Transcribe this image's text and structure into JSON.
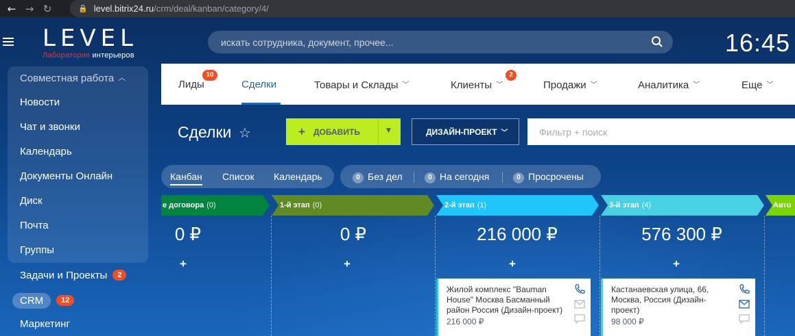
{
  "browser": {
    "url_host": "level.bitrix24.ru",
    "url_path": "/crm/deal/kanban/category/4/"
  },
  "header": {
    "logo_text": "LEVEL",
    "logo_sub_red": "Лаборатория",
    "logo_sub_rest": " интерьеров",
    "search_placeholder": "искать сотрудника, документ, прочее...",
    "clock": "16:45"
  },
  "sidebar": {
    "group_title": "Совместная работа",
    "items": [
      {
        "label": "Новости"
      },
      {
        "label": "Чат и звонки"
      },
      {
        "label": "Календарь"
      },
      {
        "label": "Документы Онлайн"
      },
      {
        "label": "Диск"
      },
      {
        "label": "Почта"
      },
      {
        "label": "Группы"
      }
    ],
    "tasks": {
      "label": "Задачи и Проекты",
      "badge": "2"
    },
    "crm": {
      "label": "CRM",
      "badge": "12"
    },
    "marketing": {
      "label": "Маркетинг"
    }
  },
  "topnav": {
    "tabs": [
      {
        "label": "Лиды",
        "counter": "10"
      },
      {
        "label": "Сделки"
      },
      {
        "label": "Товары и Склады"
      },
      {
        "label": "Клиенты",
        "counter": "2"
      },
      {
        "label": "Продажи"
      },
      {
        "label": "Аналитика"
      },
      {
        "label": "Еще"
      }
    ]
  },
  "toolbar": {
    "title": "Сделки",
    "add_label": "ДОБАВИТЬ",
    "category_label": "ДИЗАЙН-ПРОЕКТ",
    "filter_placeholder": "Фильтр + поиск"
  },
  "views": {
    "kanban": "Канбан",
    "list": "Список",
    "calendar": "Календарь"
  },
  "counters": [
    {
      "value": "0",
      "label": "Без дел"
    },
    {
      "value": "0",
      "label": "На сегодня"
    },
    {
      "value": "0",
      "label": "Просрочены"
    }
  ],
  "kanban": {
    "stages": [
      {
        "name": "е договора",
        "count": "(0)",
        "sum": "0 ₽",
        "color": "#00843f"
      },
      {
        "name": "1-й этап",
        "count": "(0)",
        "sum": "0 ₽",
        "color": "#5f8a24"
      },
      {
        "name": "2-й этап",
        "count": "(1)",
        "sum": "216 000 ₽",
        "color": "#1ec6fa"
      },
      {
        "name": "3-й этап",
        "count": "(4)",
        "sum": "576 300 ₽",
        "color": "#47d1e2"
      },
      {
        "name": "Авто",
        "count": "",
        "sum": "",
        "color": "#7bd500"
      }
    ],
    "cards": [
      {
        "title": "Жилой комплекс \"Bauman House\" Москва Басманный район Россия (Дизайн-проект)",
        "price": "216 000 ₽"
      },
      {
        "title": "Кастанаевская улица, 66, Москва, Россия (Дизайн-проект)",
        "price": "98 000 ₽"
      }
    ]
  }
}
